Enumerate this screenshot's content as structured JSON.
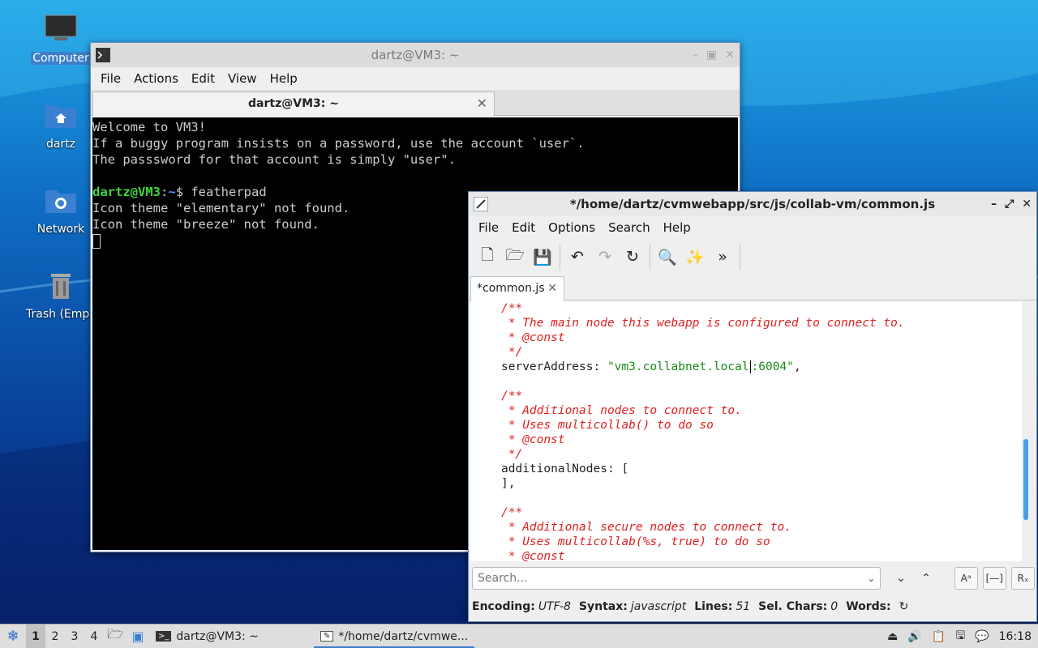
{
  "desktop": {
    "icons": [
      {
        "label": "Computer",
        "icon": "computer-icon"
      },
      {
        "label": "dartz",
        "icon": "home-folder-icon"
      },
      {
        "label": "Network",
        "icon": "network-folder-icon"
      },
      {
        "label": "Trash (Empty)",
        "icon": "trash-icon"
      }
    ]
  },
  "terminal": {
    "title": "dartz@VM3: ~",
    "menu": [
      "File",
      "Actions",
      "Edit",
      "View",
      "Help"
    ],
    "tab_label": "dartz@VM3: ~",
    "lines": [
      "Welcome to VM3!",
      "If a buggy program insists on a password, use the account `user`.",
      "The passsword for that account is simply \"user\".",
      "",
      "Icon theme \"elementary\" not found.",
      "Icon theme \"breeze\" not found."
    ],
    "prompt_user": "dartz@VM3",
    "prompt_sep": ":",
    "prompt_path": "~",
    "prompt_tail": "$ featherpad"
  },
  "featherpad": {
    "title": "*/home/dartz/cvmwebapp/src/js/collab-vm/common.js",
    "menu": [
      "File",
      "Edit",
      "Options",
      "Search",
      "Help"
    ],
    "tab_label": "*common.js",
    "code": {
      "l1": "/**",
      "l2": " * The main node this webapp is configured to connect to.",
      "l3": " * @const",
      "l4": " */",
      "l5_key": "serverAddress: ",
      "l5_str_a": "\"vm3.collabnet.local",
      "l5_str_b": ":6004\"",
      "l5_end": ",",
      "l7": "/**",
      "l8": " * Additional nodes to connect to.",
      "l9": " * Uses multicollab() to do so",
      "l10": " * @const",
      "l11": " */",
      "l12": "additionalNodes: [",
      "l13": "],",
      "l15": "/**",
      "l16": " * Additional secure nodes to connect to.",
      "l17": " * Uses multicollab(%s, true) to do so",
      "l18": " * @const"
    },
    "search_placeholder": "Search...",
    "status": {
      "encoding_label": "Encoding:",
      "encoding": "UTF-8",
      "syntax_label": "Syntax:",
      "syntax": "javascript",
      "lines_label": "Lines:",
      "lines": "51",
      "selchars_label": "Sel. Chars:",
      "selchars": "0",
      "words_label": "Words:"
    }
  },
  "taskbar": {
    "workspaces": [
      "1",
      "2",
      "3",
      "4"
    ],
    "tasks": [
      "dartz@VM3: ~",
      "*/home/dartz/cvmwe..."
    ],
    "clock": "16:18"
  },
  "colors": {
    "accent": "#3d7fc9",
    "comment": "#e02020",
    "string": "#1a8a1a",
    "prompt_user": "#43d543",
    "prompt_path": "#5c8cff"
  }
}
